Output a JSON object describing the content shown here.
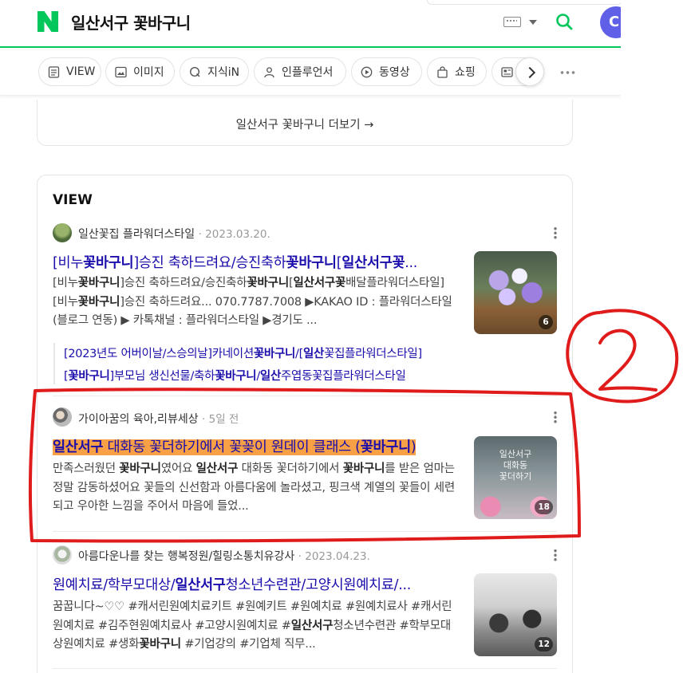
{
  "header": {
    "query": "일산서구 꽃바구니",
    "avatar_letter": "C"
  },
  "tabs": [
    {
      "label": "VIEW",
      "icon": "document-icon"
    },
    {
      "label": "이미지",
      "icon": "image-icon"
    },
    {
      "label": "지식iN",
      "icon": "q-icon"
    },
    {
      "label": "인플루언서",
      "icon": "person-icon"
    },
    {
      "label": "동영상",
      "icon": "play-icon"
    },
    {
      "label": "쇼핑",
      "icon": "bag-icon"
    }
  ],
  "more_link": "일산서구 꽃바구니 더보기 →",
  "view_section": {
    "title": "VIEW",
    "posts": [
      {
        "author": "일산꽃집 플라워더스타일",
        "date": "· 2023.03.20.",
        "title_parts": [
          "[비누",
          "꽃바구니",
          "]승진 축하드려요/승진축하",
          "꽃바구니",
          "[",
          "일산서구꽃",
          "..."
        ],
        "desc_parts": [
          "[비누",
          "꽃바구니",
          "]승진 축하드려요/승진축하",
          "꽃바구니",
          "[",
          "일산서구꽃",
          "배달플라워더스타일] [비누",
          "꽃바구니",
          "]승진 축하드려요... 070.7787.7008 ▶KAKAO ID : 플라워더스타일(블로그 연동) ▶ 카톡채널 : 플라워더스타일 ▶경기도 ..."
        ],
        "thumb_count": "6",
        "sublinks": [
          [
            "[2023년도 어버이날/스승의날]카네이션",
            "꽃바구니",
            "/[",
            "일산",
            "꽃집플라워더스타일]"
          ],
          [
            "[",
            "꽃바구니",
            "]부모님 생신선물/축하",
            "꽃바구니",
            "/",
            "일산",
            "주엽동꽃집플라워더스타일"
          ]
        ]
      },
      {
        "author": "가이아꿈의 육아,리뷰세상",
        "date": "· 5일 전",
        "title_parts": [
          "일산서구",
          " 대화동 꽃더하기에서 꽃꽂이 원데이 클래스 (",
          "꽃바구니",
          ")"
        ],
        "desc_parts": [
          "만족스러웠던 ",
          "꽃바구니",
          "였어요 ",
          "일산서구",
          " 대화동 꽃더하기에서 ",
          "꽃바구니",
          "를 받은 엄마는 정말 감동하셨어요 꽃들의 신선함과 아름다움에 놀라셨고, 핑크색 계열의 꽃들이 세련되고 우아한 느낌을 주어서 마음에 들었..."
        ],
        "thumb_text": "일산서구\n대화동\n꽃더하기",
        "thumb_count": "18"
      },
      {
        "author": "아름다운나를 찾는 행복정원/힐링소통치유강사",
        "date": "· 2023.04.23.",
        "title_parts": [
          "원예치료/학부모대상/",
          "일산서구",
          "청소년수련관/고양시원예치료/..."
        ],
        "desc_parts": [
          "꿈꿉니다~♡♡ #캐서린원예치료키트 #원예키트 #원예치료 #원예치료사 #캐서린원예치료 #김주현원예치료사 #고양시원예치료 #",
          "일산서구",
          "청소년수련관 #학부모대상원예치료 #생화",
          "꽃바구니",
          " #기업강의 #기업체 직무..."
        ],
        "thumb_count": "12"
      }
    ]
  },
  "annotation": {
    "label": "2",
    "color": "#e01b1b"
  },
  "colors": {
    "brand_green": "#03c75a",
    "link_blue": "#1a0dab",
    "highlight": "#f7a046"
  }
}
